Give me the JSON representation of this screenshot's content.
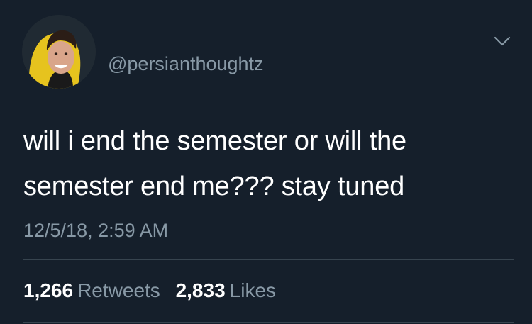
{
  "tweet": {
    "handle": "@persianthoughtz",
    "text": "will i end the semester or will the semester end me??? stay tuned",
    "timestamp": "12/5/18, 2:59 AM",
    "retweets": {
      "count": "1,266",
      "label": "Retweets"
    },
    "likes": {
      "count": "2,833",
      "label": "Likes"
    }
  },
  "colors": {
    "background": "#151f2b",
    "text_primary": "#ffffff",
    "text_secondary": "#8899a6",
    "divider": "#37444f"
  },
  "icons": {
    "avatar": "profile-photo",
    "menu": "chevron-down-icon"
  }
}
